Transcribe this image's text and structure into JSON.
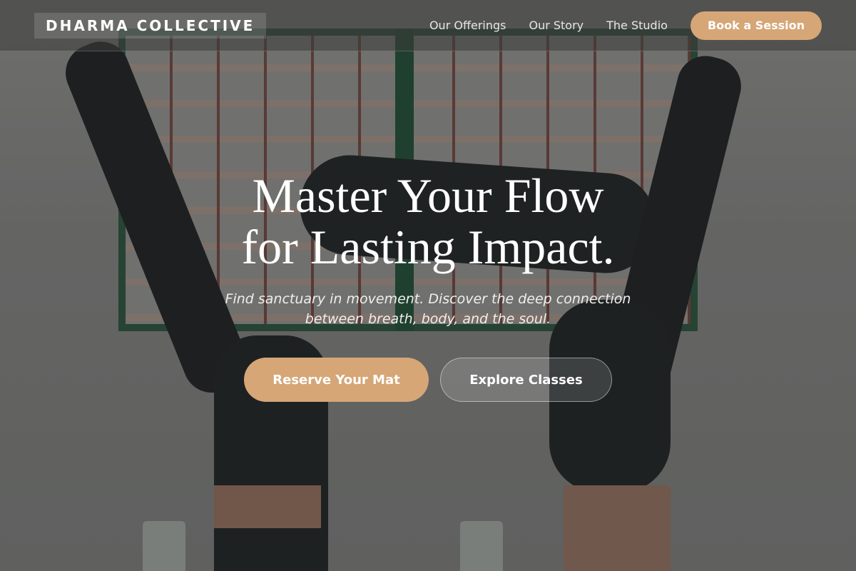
{
  "header": {
    "logo": "DHARMA COLLECTIVE",
    "nav": [
      {
        "label": "Our Offerings"
      },
      {
        "label": "Our Story"
      },
      {
        "label": "The Studio"
      }
    ],
    "cta_label": "Book a Session"
  },
  "hero": {
    "title_line1": "Master Your Flow",
    "title_line2": "for Lasting Impact.",
    "subtitle": "Find sanctuary in movement. Discover the deep connection between breath, body, and the soul.",
    "primary_button": "Reserve Your Mat",
    "secondary_button": "Explore Classes"
  },
  "colors": {
    "accent": "#d6a676",
    "text": "#ffffff"
  }
}
